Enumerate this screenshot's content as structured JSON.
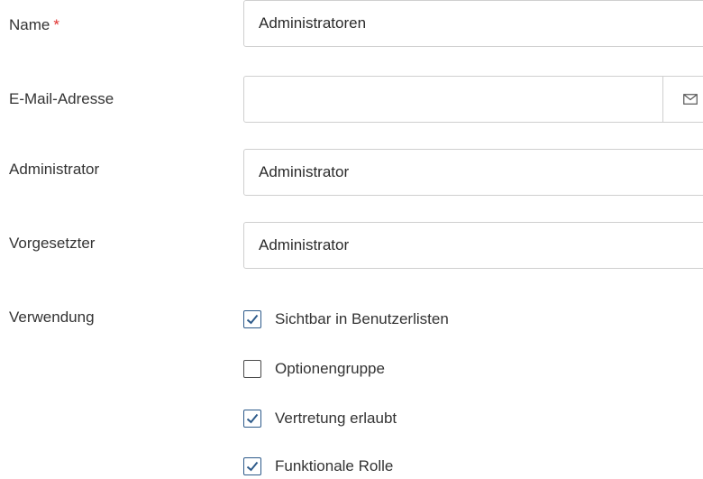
{
  "form": {
    "name": {
      "label": "Name",
      "required_marker": "*",
      "value": "Administratoren"
    },
    "email": {
      "label": "E-Mail-Adresse",
      "value": "",
      "button_icon": "mail-icon"
    },
    "administrator": {
      "label": "Administrator",
      "value": "Administrator"
    },
    "supervisor": {
      "label": "Vorgesetzter",
      "value": "Administrator"
    },
    "usage": {
      "label": "Verwendung",
      "options": [
        {
          "label": "Sichtbar in Benutzerlisten",
          "checked": true
        },
        {
          "label": "Optionengruppe",
          "checked": false
        },
        {
          "label": "Vertretung erlaubt",
          "checked": true
        },
        {
          "label": "Funktionale Rolle",
          "checked": true
        }
      ]
    }
  },
  "colors": {
    "required": "#e0312e",
    "checkmark": "#2d5a8a",
    "border": "#cfcfcf"
  }
}
